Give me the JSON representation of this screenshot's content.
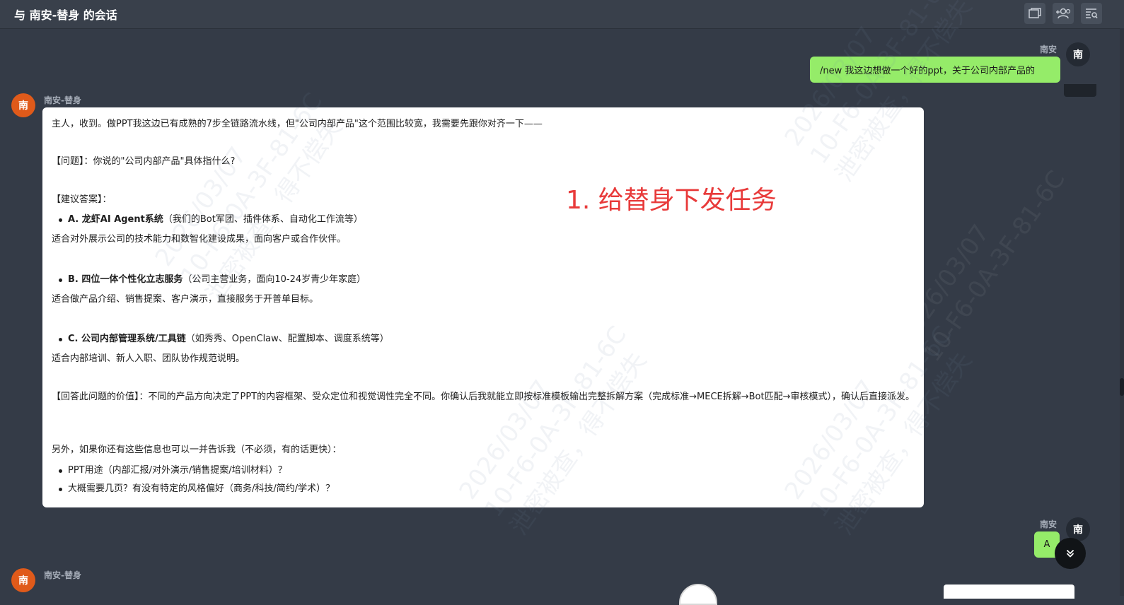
{
  "header": {
    "title": "与 南安-替身 的会话"
  },
  "messages": {
    "user1": {
      "sender": "南安",
      "avatar_text": "南",
      "text": "/new  我这边想做一个好的ppt，关于公司内部产品的"
    },
    "bot1": {
      "sender": "南安-替身",
      "avatar_text": "南",
      "intro": "主人，收到。做PPT我这边已有成熟的7步全链路流水线，但\"公司内部产品\"这个范围比较宽，我需要先跟你对齐一下——",
      "question": "【问题】：你说的\"公司内部产品\"具体指什么?",
      "suggest_title": "【建议答案】：",
      "option_a_bold": "A. 龙虾AI Agent系统",
      "option_a_rest": "（我们的Bot军团、插件体系、自动化工作流等）",
      "option_a_desc": "适合对外展示公司的技术能力和数智化建设成果，面向客户或合作伙伴。",
      "option_b_bold": "B. 四位一体个性化立志服务",
      "option_b_rest": "（公司主营业务，面向10-24岁青少年家庭）",
      "option_b_desc": "适合做产品介绍、销售提案、客户演示，直接服务于开普单目标。",
      "option_c_bold": "C. 公司内部管理系统/工具链",
      "option_c_rest": "（如秀秀、OpenClaw、配置脚本、调度系统等）",
      "option_c_desc": "适合内部培训、新人入职、团队协作规范说明。",
      "value_text": "【回答此问题的价值】：不同的产品方向决定了PPT的内容框架、受众定位和视觉调性完全不同。你确认后我就能立即按标准模板输出完整拆解方案（完成标准→MECE拆解→Bot匹配→审核模式），确认后直接派发。",
      "extra_intro": "另外，如果你还有这些信息也可以一并告诉我（不必须，有的话更快）：",
      "extra_item1": "PPT用途（内部汇报/对外演示/销售提案/培训材料）？",
      "extra_item2": "大概需要几页？有没有特定的风格偏好（商务/科技/简约/学术）？"
    },
    "user2": {
      "sender": "南安",
      "avatar_text": "南",
      "text": "A"
    },
    "bot2": {
      "sender": "南安-替身",
      "avatar_text": "南"
    }
  },
  "annotation": "1. 给替身下发任务",
  "watermark": {
    "date": "2026/03/07",
    "code": "10-F6-0A-3F-81-6C",
    "warning": "泄密被查，得不偿失"
  },
  "icons": [
    "window-icon",
    "add-member-icon",
    "search-list-icon",
    "chevron-down-icon"
  ]
}
